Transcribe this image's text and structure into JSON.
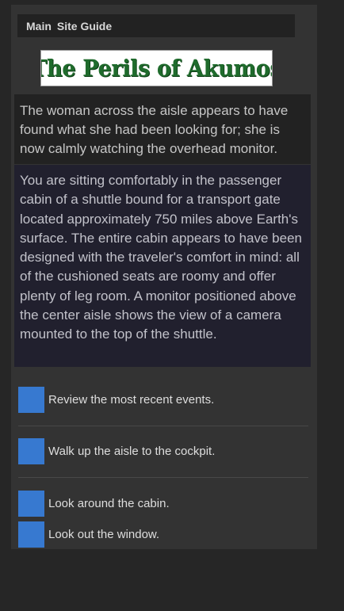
{
  "nav": {
    "main_label": "Main",
    "guide_label": "Site Guide"
  },
  "logo": {
    "title": "The Perils of Akumos"
  },
  "event_text": "The woman across the aisle appears to have found what she had been looking for; she is now calmly watching the overhead monitor.",
  "description": "You are sitting comfortably in the passenger cabin of a shuttle bound for a transport gate located approximately 750 miles above Earth's surface. The entire cabin appears to have been designed with the traveler's comfort in mind: all of the cushioned seats are roomy and offer plenty of leg room. A monitor positioned above the center aisle shows the view of a camera mounted to the top of the shuttle.",
  "options": [
    {
      "label": "Review the most recent events."
    },
    {
      "label": "Walk up the aisle to the cockpit."
    },
    {
      "label": "Look around the cabin."
    },
    {
      "label": "Look out the window."
    }
  ],
  "colors": {
    "page_bg": "#262626",
    "panel_bg": "#333333",
    "nav_bg": "#222222",
    "description_bg": "#21202e",
    "option_button": "#3779d0",
    "logo_text": "#1f6b2c"
  }
}
